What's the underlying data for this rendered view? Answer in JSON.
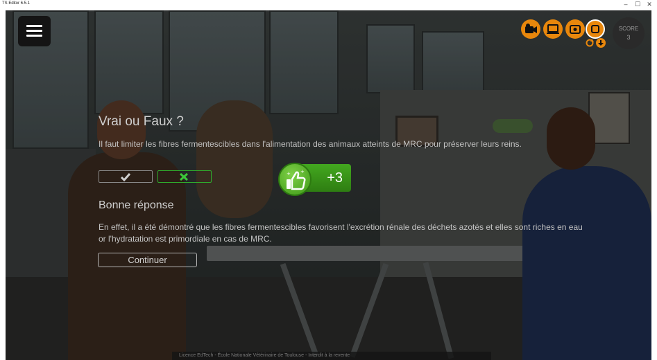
{
  "window": {
    "title": "TS Editor 6.5.1",
    "minimize_glyph": "–",
    "maximize_glyph": "☐",
    "close_glyph": "✕"
  },
  "toolbar": {
    "icons": [
      "menu-icon",
      "video-camera-icon",
      "screen-icon",
      "camera-icon",
      "stop-icon",
      "refresh-icon",
      "download-icon"
    ],
    "accent_color": "#e8870c"
  },
  "score": {
    "label": "SCORE",
    "value": "3"
  },
  "quiz": {
    "title": "Vrai ou Faux ?",
    "question": "Il faut limiter les fibres fermentescibles dans l'alimentation des animaux atteints de MRC pour préserver leurs reins.",
    "true_icon": "check-icon",
    "false_icon": "cross-icon",
    "selected": "false"
  },
  "feedback": {
    "title": "Bonne réponse",
    "text": "En effet, il a été démontré que les fibres fermentescibles favorisent l'excrétion rénale des déchets azotés et elles sont riches en eau or l'hydratation est primordiale en cas de MRC.",
    "continue_label": "Continuer"
  },
  "points": {
    "value": "+3",
    "icon": "thumbs-up-icon",
    "color": "#43a81f"
  },
  "footer": {
    "text": "Licence EdTech - École Nationale Vétérinaire de Toulouse - Interdit à la revente"
  }
}
